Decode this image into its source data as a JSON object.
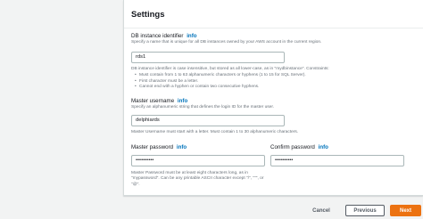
{
  "settings": {
    "title": "Settings",
    "db_identifier": {
      "label": "DB instance identifier",
      "info": "info",
      "description": "Specify a name that is unique for all DB instances owned by your AWS account in the current region.",
      "value": "rds1",
      "hint": "DB instance identifier is case insensitive, but stored as all lower-case, as in \"mydbinstance\". Constraints:",
      "constraints": [
        "Must contain from 1 to 63 alphanumeric characters or hyphens (1 to 15 for SQL Server).",
        "First character must be a letter.",
        "Cannot end with a hyphen or contain two consecutive hyphens."
      ]
    },
    "master_username": {
      "label": "Master username",
      "info": "info",
      "description": "Specify an alphanumeric string that defines the login ID for the master user.",
      "value": "delphiards",
      "hint": "Master Username must start with a letter. Must contain 1 to 30 alphanumeric characters."
    },
    "master_password": {
      "label": "Master password",
      "info": "info",
      "value": "••••••••••",
      "hint": "Master Password must be at least eight characters long, as in \"mypassword\". Can be any printable ASCII character except \"/\", \"\"\", or \"@\"."
    },
    "confirm_password": {
      "label": "Confirm password",
      "info": "info",
      "value": "••••••••••"
    }
  },
  "footer": {
    "cancel": "Cancel",
    "previous": "Previous",
    "next": "Next"
  },
  "colors": {
    "accent": "#ec7211",
    "link": "#0073bb"
  }
}
